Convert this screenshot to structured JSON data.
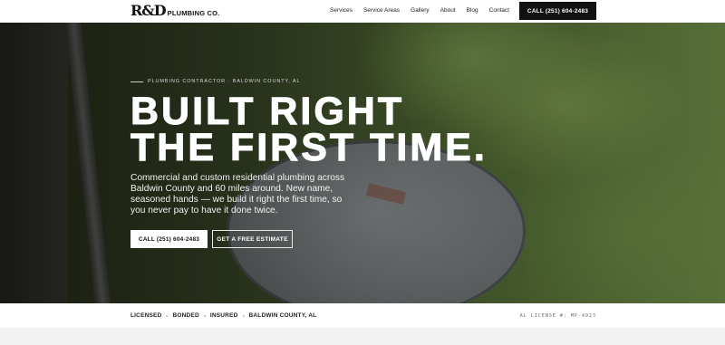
{
  "nav": {
    "logo_mark": "R&D",
    "logo_text": "PLUMBING CO.",
    "links": [
      "Services",
      "Service Areas",
      "Gallery",
      "About",
      "Blog",
      "Contact"
    ],
    "cta": "CALL (251) 604-2483"
  },
  "hero": {
    "eyebrow": "PLUMBING CONTRACTOR · BALDWIN COUNTY, AL",
    "headline_line1": "BUILT RIGHT",
    "headline_line2": "THE FIRST TIME.",
    "subtext": "Commercial and custom residential plumbing across Baldwin County and 60 miles around. New name, seasoned hands — we build it right the first time, so you never pay to have it done twice.",
    "primary_button": "CALL (251) 604-2483",
    "secondary_button": "GET A FREE ESTIMATE"
  },
  "trust": {
    "items": [
      "LICENSED",
      "BONDED",
      "INSURED",
      "BALDWIN COUNTY, AL"
    ],
    "license": "AL LICENSE #: MP-4923"
  }
}
